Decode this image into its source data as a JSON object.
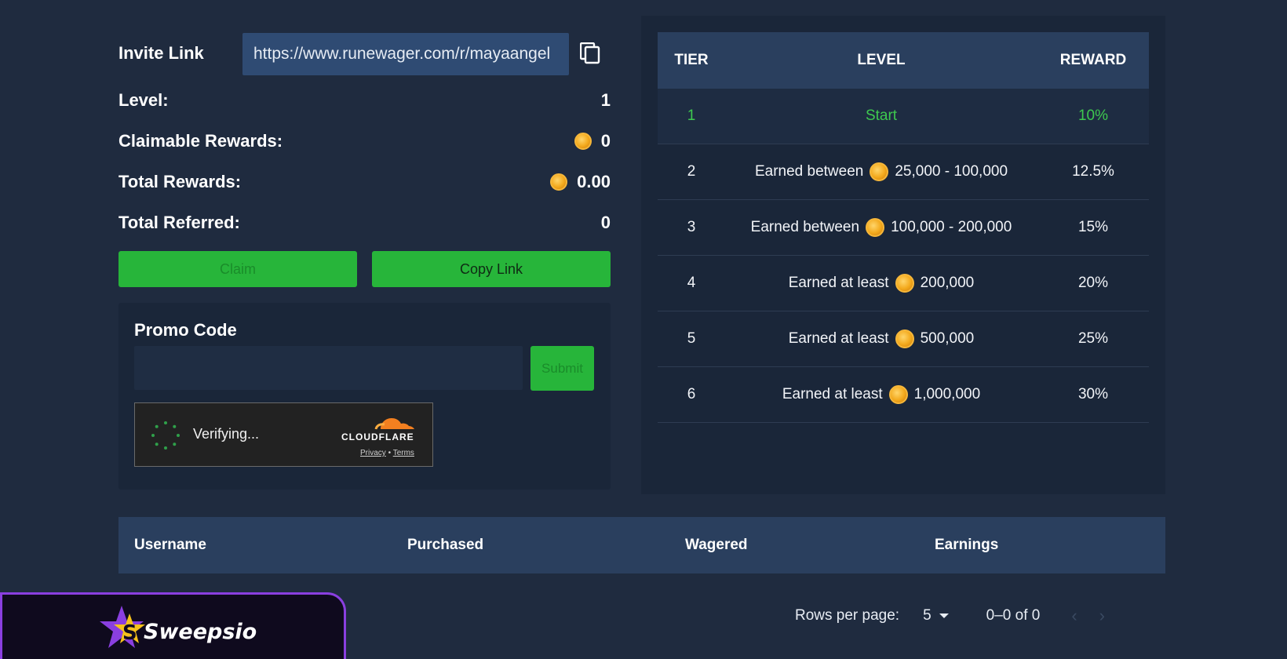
{
  "referral": {
    "invite_label": "Invite Link",
    "invite_url": "https://www.runewager.com/r/mayaangel",
    "stats": [
      {
        "label": "Level:",
        "value": "1",
        "coin": false
      },
      {
        "label": "Claimable Rewards:",
        "value": "0",
        "coin": true
      },
      {
        "label": "Total Rewards:",
        "value": "0.00",
        "coin": true
      },
      {
        "label": "Total Referred:",
        "value": "0",
        "coin": false
      }
    ],
    "claim_label": "Claim",
    "copy_label": "Copy Link"
  },
  "promo": {
    "title": "Promo Code",
    "input_value": "",
    "submit_label": "Submit",
    "captcha": {
      "status": "Verifying...",
      "brand": "CLOUDFLARE",
      "privacy": "Privacy",
      "separator": "•",
      "terms": "Terms"
    }
  },
  "tiers": {
    "headers": {
      "tier": "TIER",
      "level": "LEVEL",
      "reward": "REWARD"
    },
    "rows": [
      {
        "tier": "1",
        "prefix": "Start",
        "coin": false,
        "amount": "",
        "reward": "10%"
      },
      {
        "tier": "2",
        "prefix": "Earned between",
        "coin": true,
        "amount": "25,000 - 100,000",
        "reward": "12.5%"
      },
      {
        "tier": "3",
        "prefix": "Earned between",
        "coin": true,
        "amount": "100,000 - 200,000",
        "reward": "15%"
      },
      {
        "tier": "4",
        "prefix": "Earned at least",
        "coin": true,
        "amount": "200,000",
        "reward": "20%"
      },
      {
        "tier": "5",
        "prefix": "Earned at least",
        "coin": true,
        "amount": "500,000",
        "reward": "25%"
      },
      {
        "tier": "6",
        "prefix": "Earned at least",
        "coin": true,
        "amount": "1,000,000",
        "reward": "30%"
      }
    ]
  },
  "referrals_table": {
    "columns": [
      "Username",
      "Purchased",
      "Wagered",
      "Earnings"
    ],
    "rows_per_page_label": "Rows per page:",
    "rows_per_page_value": "5",
    "range": "0–0 of 0",
    "prev_icon": "‹",
    "next_icon": "›"
  },
  "branding": {
    "name": "Sweepsio",
    "accent": "#8a3fe0",
    "star_color": "#f5c21b"
  },
  "colors": {
    "primary_green": "#27b53a",
    "active_tier_green": "#3ec94f",
    "panel": "#1a2639",
    "header": "#2a3f5e"
  }
}
